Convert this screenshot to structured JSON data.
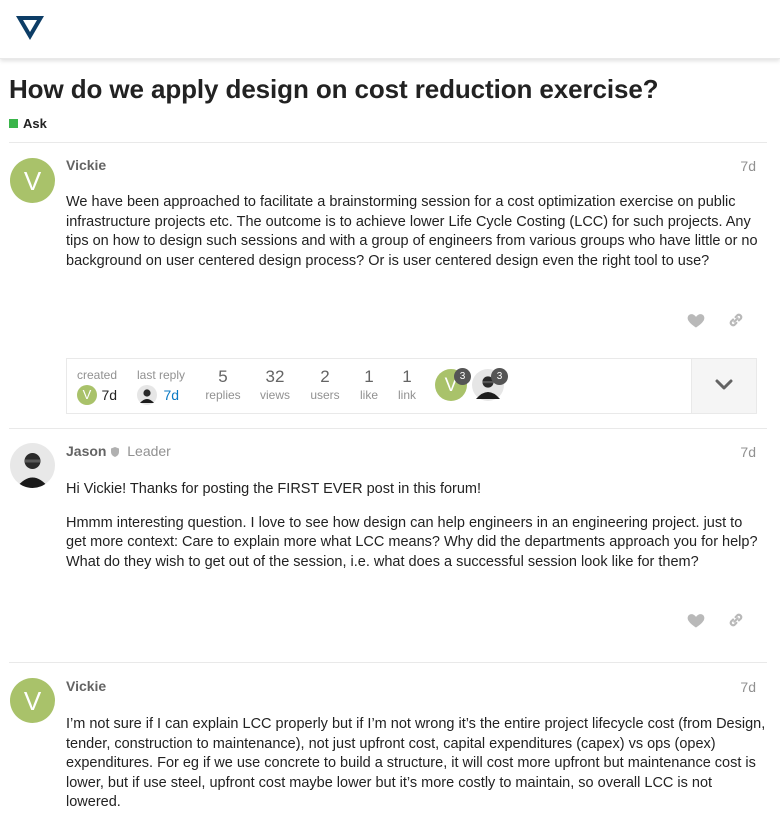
{
  "header": {
    "logo_icon": "triangle-logo-icon"
  },
  "topic": {
    "title": "How do we apply design on cost reduction exercise?",
    "category": "Ask",
    "category_color": "#3ab54a"
  },
  "posts": [
    {
      "username": "Vickie",
      "avatar_letter": "V",
      "date": "7d",
      "paragraphs": [
        "We have been approached to facilitate a brainstorming session for a cost optimization exercise on public infrastructure projects etc. The outcome is to achieve lower Life Cycle Costing (LCC) for such projects. Any tips on how to design such sessions and with a group of engineers from various groups who have little or no background on user centered design process? Or is user centered design even the right tool to use?"
      ]
    },
    {
      "username": "Jason",
      "badge": "Leader",
      "date": "7d",
      "paragraphs": [
        "Hi Vickie! Thanks for posting the FIRST EVER post in this forum!",
        "Hmmm interesting question. I love to see how design can help engineers in an engineering project. just to get more context: Care to explain more what LCC means? Why did the departments approach you for help? What do they wish to get out of the session, i.e. what does a successful session look like for them?"
      ]
    },
    {
      "username": "Vickie",
      "avatar_letter": "V",
      "date": "7d",
      "paragraphs": [
        "I’m not sure if I can explain LCC properly but if I’m not wrong it’s the entire project lifecycle cost (from Design, tender, construction to maintenance), not just upfront cost, capital expenditures (capex) vs ops (opex) expenditures. For eg if we use concrete to build a structure, it will cost more upfront but maintenance cost is lower, but if use steel, upfront cost maybe lower but it’s more costly to maintain, so overall LCC is not lowered."
      ]
    }
  ],
  "summary": {
    "created_label": "created",
    "created_value": "7d",
    "last_reply_label": "last reply",
    "last_reply_value": "7d",
    "replies_count": "5",
    "replies_label": "replies",
    "views_count": "32",
    "views_label": "views",
    "users_count": "2",
    "users_label": "users",
    "likes_count": "1",
    "likes_label": "like",
    "links_count": "1",
    "links_label": "link",
    "participants": [
      {
        "letter": "V",
        "posts": "3"
      },
      {
        "posts": "3"
      }
    ]
  },
  "colors": {
    "avatar_green": "#a9c26a",
    "link_blue": "#0a7ac4",
    "muted": "#919191"
  }
}
